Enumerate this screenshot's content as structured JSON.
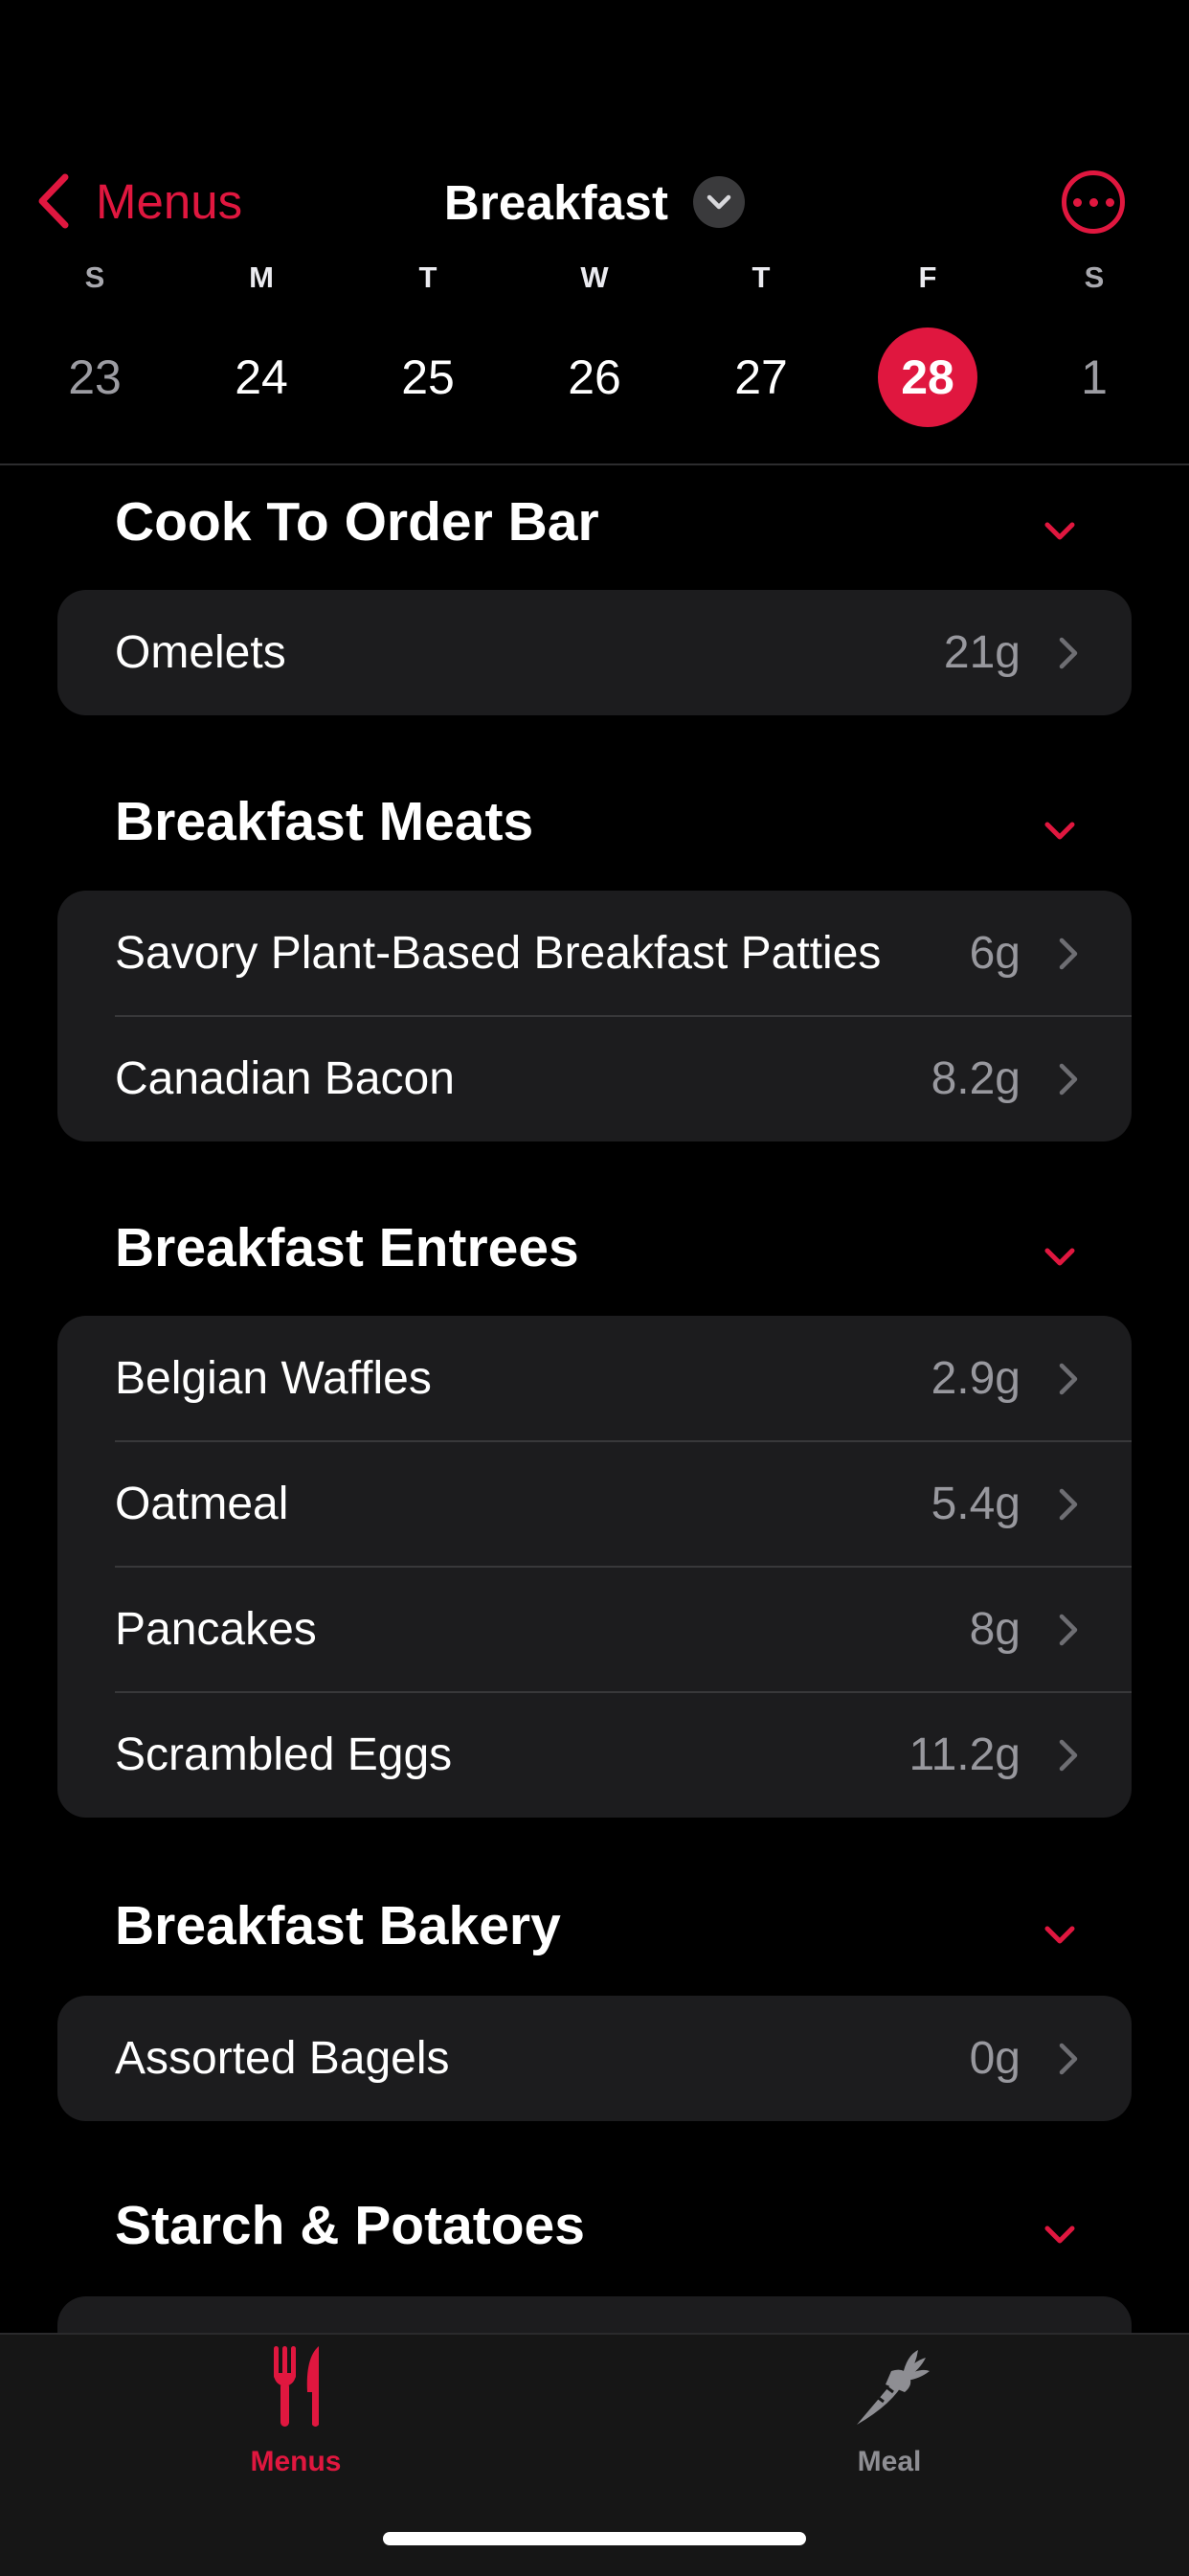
{
  "header": {
    "back_label": "Menus",
    "title": "Breakfast"
  },
  "colors": {
    "accent": "#e0173f",
    "background": "#000000",
    "card": "#1c1c1e",
    "secondary_text": "#98989e"
  },
  "calendar": {
    "days": [
      {
        "letter": "S",
        "date": "23"
      },
      {
        "letter": "M",
        "date": "24"
      },
      {
        "letter": "T",
        "date": "25"
      },
      {
        "letter": "W",
        "date": "26"
      },
      {
        "letter": "T",
        "date": "27"
      },
      {
        "letter": "F",
        "date": "28",
        "selected": true
      },
      {
        "letter": "S",
        "date": "1"
      }
    ]
  },
  "sections": [
    {
      "title": "Cook To Order Bar",
      "items": [
        {
          "name": "Omelets",
          "value": "21g"
        }
      ]
    },
    {
      "title": "Breakfast Meats",
      "items": [
        {
          "name": "Savory Plant-Based Breakfast Patties",
          "value": "6g"
        },
        {
          "name": "Canadian Bacon",
          "value": "8.2g"
        }
      ]
    },
    {
      "title": "Breakfast Entrees",
      "items": [
        {
          "name": "Belgian Waffles",
          "value": "2.9g"
        },
        {
          "name": "Oatmeal",
          "value": "5.4g"
        },
        {
          "name": "Pancakes",
          "value": "8g"
        },
        {
          "name": "Scrambled Eggs",
          "value": "11.2g"
        }
      ]
    },
    {
      "title": "Breakfast Bakery",
      "items": [
        {
          "name": "Assorted Bagels",
          "value": "0g"
        }
      ]
    },
    {
      "title": "Starch & Potatoes",
      "items": []
    }
  ],
  "tabs": [
    {
      "label": "Menus",
      "icon": "fork-knife-icon",
      "active": true
    },
    {
      "label": "Meal",
      "icon": "carrot-icon",
      "active": false
    }
  ]
}
